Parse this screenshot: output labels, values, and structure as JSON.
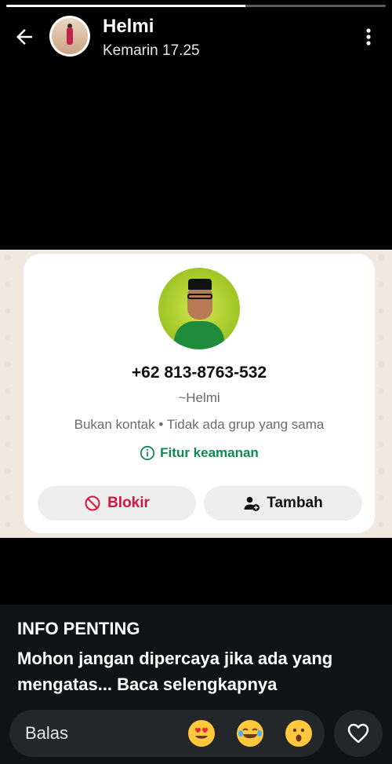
{
  "status": {
    "progress_fraction": 0.63
  },
  "header": {
    "contact_name": "Helmi",
    "timestamp": "Kemarin 17.25",
    "back_icon": "arrow-left-icon",
    "menu_icon": "more-vertical-icon"
  },
  "card": {
    "phone": "+62 813-8763-532",
    "push_name": "~Helmi",
    "meta": "Bukan kontak • Tidak ada grup yang sama",
    "safety_label": "Fitur keamanan",
    "block_label": "Blokir",
    "add_label": "Tambah"
  },
  "caption": {
    "title": "INFO PENTING",
    "body": "Mohon jangan dipercaya jika ada yang mengatas...",
    "read_more": "Baca selengkapnya"
  },
  "reply": {
    "placeholder": "Balas",
    "emojis": [
      "heart-eyes-emoji",
      "tears-of-joy-emoji",
      "astonished-emoji"
    ],
    "like_icon": "heart-icon"
  },
  "colors": {
    "accent_green": "#0f8a4f",
    "danger_red": "#d4163c"
  }
}
